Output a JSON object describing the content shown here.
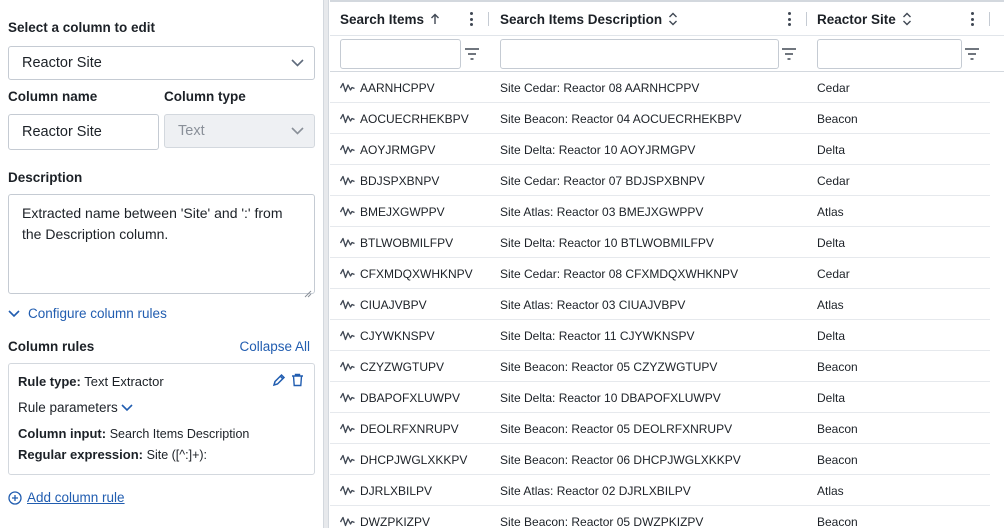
{
  "left_panel": {
    "select_column_label": "Select a column to edit",
    "selected_column": "Reactor Site",
    "column_name_label": "Column name",
    "column_name_value": "Reactor Site",
    "column_type_label": "Column type",
    "column_type_value": "Text",
    "description_label": "Description",
    "description_text": "Extracted name between 'Site' and ':' from the Description column.",
    "configure_rules_label": "Configure column rules",
    "column_rules_label": "Column rules",
    "collapse_all_label": "Collapse All",
    "rule": {
      "rule_type_key": "Rule type:",
      "rule_type_value": "Text Extractor",
      "rule_parameters_label": "Rule parameters",
      "column_input_key": "Column input:",
      "column_input_value": "Search Items Description",
      "regex_key": "Regular expression:",
      "regex_value": "Site ([^:]+):"
    },
    "add_rule_label": "Add column rule"
  },
  "grid": {
    "columns": [
      {
        "title": "Search Items",
        "sort": "ascending"
      },
      {
        "title": "Search Items Description",
        "sort": "unsorted"
      },
      {
        "title": "Reactor Site",
        "sort": "unsorted"
      }
    ],
    "rows": [
      [
        "AARNHCPPV",
        "Site Cedar: Reactor 08 AARNHCPPV",
        "Cedar"
      ],
      [
        "AOCUECRHEKBPV",
        "Site Beacon: Reactor 04 AOCUECRHEKBPV",
        "Beacon"
      ],
      [
        "AOYJRMGPV",
        "Site Delta: Reactor 10 AOYJRMGPV",
        "Delta"
      ],
      [
        "BDJSPXBNPV",
        "Site Cedar: Reactor 07 BDJSPXBNPV",
        "Cedar"
      ],
      [
        "BMEJXGWPPV",
        "Site Atlas: Reactor 03 BMEJXGWPPV",
        "Atlas"
      ],
      [
        "BTLWOBMILFPV",
        "Site Delta: Reactor 10 BTLWOBMILFPV",
        "Delta"
      ],
      [
        "CFXMDQXWHKNPV",
        "Site Cedar: Reactor 08 CFXMDQXWHKNPV",
        "Cedar"
      ],
      [
        "CIUAJVBPV",
        "Site Atlas: Reactor 03 CIUAJVBPV",
        "Atlas"
      ],
      [
        "CJYWKNSPV",
        "Site Delta: Reactor 11 CJYWKNSPV",
        "Delta"
      ],
      [
        "CZYZWGTUPV",
        "Site Beacon: Reactor 05 CZYZWGTUPV",
        "Beacon"
      ],
      [
        "DBAPOFXLUWPV",
        "Site Delta: Reactor 10 DBAPOFXLUWPV",
        "Delta"
      ],
      [
        "DEOLRFXNRUPV",
        "Site Beacon: Reactor 05 DEOLRFXNRUPV",
        "Beacon"
      ],
      [
        "DHCPJWGLXKKPV",
        "Site Beacon: Reactor 06 DHCPJWGLXKKPV",
        "Beacon"
      ],
      [
        "DJRLXBILPV",
        "Site Atlas: Reactor 02 DJRLXBILPV",
        "Atlas"
      ],
      [
        "DWZPKIZPV",
        "Site Beacon: Reactor 05 DWZPKIZPV",
        "Beacon"
      ]
    ],
    "row_icon": "waveform-icon"
  },
  "colors": {
    "link": "#215db0",
    "text": "#1c2127",
    "border": "#c5cbd3"
  }
}
